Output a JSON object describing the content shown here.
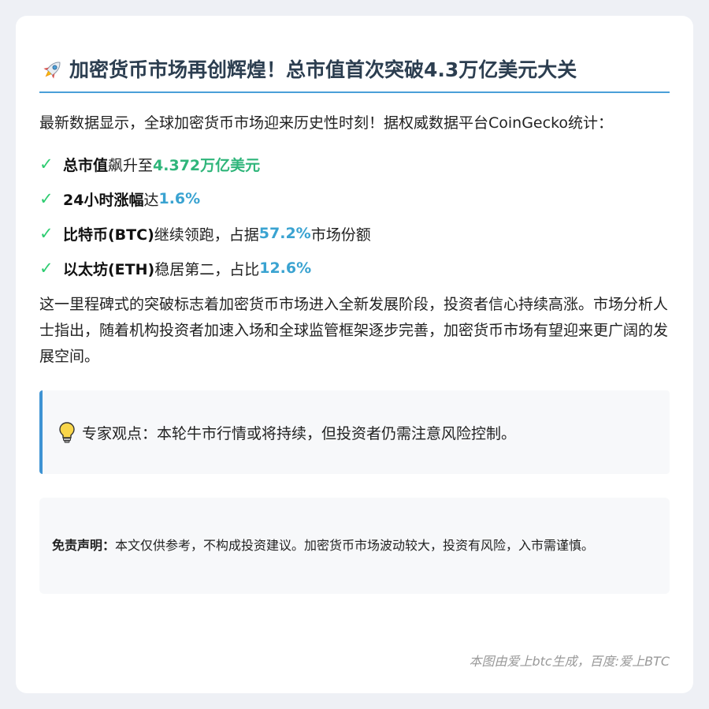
{
  "article": {
    "title": "加密货币市场再创辉煌！总市值首次突破4.3万亿美元大关",
    "intro": "最新数据显示，全球加密货币市场迎来历史性时刻！据权威数据平台CoinGecko统计：",
    "stats": [
      {
        "label": "总市值",
        "mid": "飙升至",
        "value": "4.372万亿美元",
        "tail": ""
      },
      {
        "label": "24小时涨幅",
        "mid": "达",
        "value": "1.6%",
        "tail": ""
      },
      {
        "label": "比特币(BTC)",
        "mid": "继续领跑，占据",
        "value": "57.2%",
        "tail": "市场份额"
      },
      {
        "label": "以太坊(ETH)",
        "mid": "稳居第二，占比",
        "value": "12.6%",
        "tail": ""
      }
    ],
    "body": "这一里程碑式的突破标志着加密货币市场进入全新发展阶段，投资者信心持续高涨。市场分析人士指出，随着机构投资者加速入场和全球监管框架逐步完善，加密货币市场有望迎来更广阔的发展空间。",
    "expert": "专家观点：本轮牛市行情或将持续，但投资者仍需注意风险控制。",
    "disclaimer_label": "免责声明：",
    "disclaimer_text": "本文仅供参考，不构成投资建议。加密货币市场波动较大，投资有风险，入市需谨慎。",
    "footer": "本图由爱上btc生成，百度:爱上BTC"
  },
  "icons": {
    "title": "rocket-icon",
    "check": "check-icon",
    "expert": "lightbulb-icon"
  },
  "colors": {
    "accent_blue": "#3aa3d1",
    "accent_green": "#2fb57a",
    "check_green": "#2ecc71",
    "title_text": "#2c3e50",
    "rule": "#4a9fd8"
  }
}
